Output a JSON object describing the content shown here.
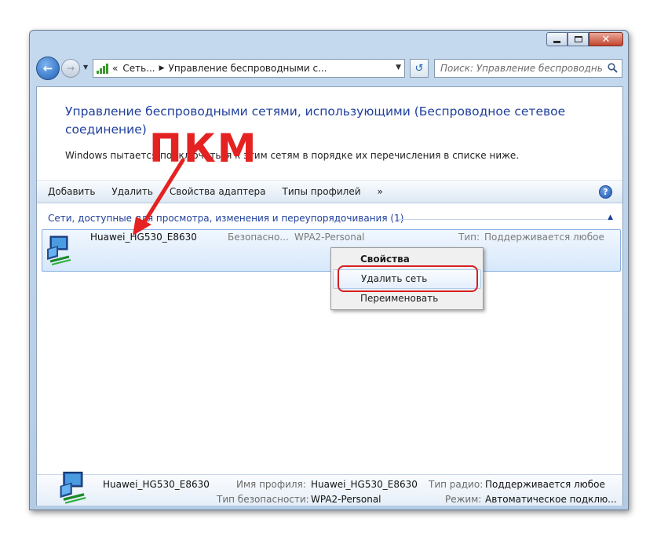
{
  "window": {
    "caption_buttons": {
      "minimize": "minimize-glyph",
      "maximize": "maximize-glyph",
      "close": "✕"
    }
  },
  "navbar": {
    "back_glyph": "←",
    "forward_glyph": "→",
    "breadcrumb_prefix": "«",
    "breadcrumbs": [
      "Сеть...",
      "Управление беспроводными с..."
    ],
    "refresh_glyph": "↺",
    "search_placeholder": "Поиск: Управление беспроводными ..."
  },
  "page": {
    "title": "Управление беспроводными сетями, использующими (Беспроводное сетевое соединение)",
    "description": "Windows пытается подключиться к этим сетям в порядке их перечисления в списке ниже."
  },
  "toolbar": {
    "items": [
      "Добавить",
      "Удалить",
      "Свойства адаптера",
      "Типы профилей"
    ],
    "more": "»",
    "help": "?"
  },
  "group": {
    "header": "Сети, доступные для просмотра, изменения и переупорядочивания (1)",
    "collapse_glyph": "▲"
  },
  "network_row": {
    "name": "Huawei_HG530_E8630",
    "security_label": "Безопасно...",
    "security_value": "WPA2-Personal",
    "type_label": "Тип:",
    "type_value": "Поддерживается любое"
  },
  "context_menu": {
    "items": [
      "Свойства",
      "Удалить сеть",
      "Переименовать"
    ]
  },
  "annotation": {
    "text": "ПКМ",
    "color": "#e52222"
  },
  "details": {
    "name": "Huawei_HG530_E8630",
    "profile_label": "Имя профиля:",
    "profile_value": "Huawei_HG530_E8630",
    "security_label": "Тип безопасности:",
    "security_value": "WPA2-Personal",
    "radio_label": "Тип радио:",
    "radio_value": "Поддерживается любое",
    "mode_label": "Режим:",
    "mode_value": "Автоматическое подклю..."
  },
  "colors": {
    "link_blue": "#1e3f9c",
    "annotation_red": "#e52222",
    "selection_border": "#86aee0"
  }
}
